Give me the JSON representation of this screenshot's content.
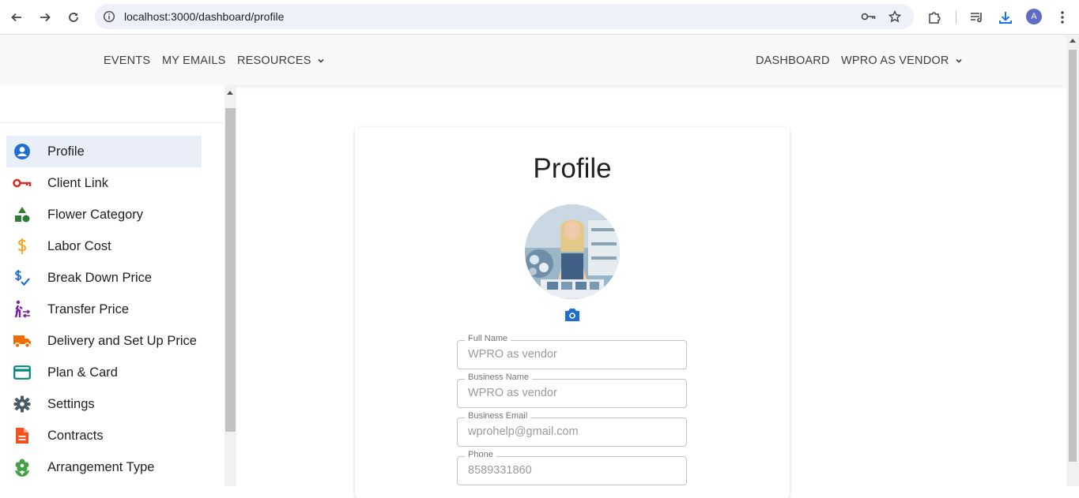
{
  "browser": {
    "url": "localhost:3000/dashboard/profile",
    "avatar_letter": "A"
  },
  "topnav": {
    "events": "EVENTS",
    "my_emails": "MY EMAILS",
    "resources": "RESOURCES",
    "dashboard": "DASHBOARD",
    "account": "WPRO AS VENDOR"
  },
  "sidebar": {
    "items": [
      {
        "label": "Profile",
        "icon": "account-circle-icon",
        "color": "#1e6fd0",
        "active": true
      },
      {
        "label": "Client Link",
        "icon": "key-icon",
        "color": "#d32f2f"
      },
      {
        "label": "Flower Category",
        "icon": "category-shapes-icon",
        "color": "#2e7d32"
      },
      {
        "label": "Labor Cost",
        "icon": "dollar-icon",
        "color": "#f9a825"
      },
      {
        "label": "Break Down Price",
        "icon": "price-check-icon",
        "color": "#1e6fd0"
      },
      {
        "label": "Transfer Price",
        "icon": "transfer-person-icon",
        "color": "#7b1fa2"
      },
      {
        "label": "Delivery and Set Up Price",
        "icon": "truck-icon",
        "color": "#ef6c00"
      },
      {
        "label": "Plan & Card",
        "icon": "credit-card-icon",
        "color": "#00897b"
      },
      {
        "label": "Settings",
        "icon": "gear-icon",
        "color": "#455a64"
      },
      {
        "label": "Contracts",
        "icon": "document-icon",
        "color": "#f4511e"
      },
      {
        "label": "Arrangement Type",
        "icon": "flower-icon",
        "color": "#43a047"
      }
    ]
  },
  "profile": {
    "title": "Profile",
    "fields": [
      {
        "label": "Full Name",
        "value": "WPRO as vendor"
      },
      {
        "label": "Business Name",
        "value": "WPRO as vendor"
      },
      {
        "label": "Business Email",
        "value": "wprohelp@gmail.com"
      },
      {
        "label": "Phone",
        "value": "8589331860"
      }
    ]
  }
}
